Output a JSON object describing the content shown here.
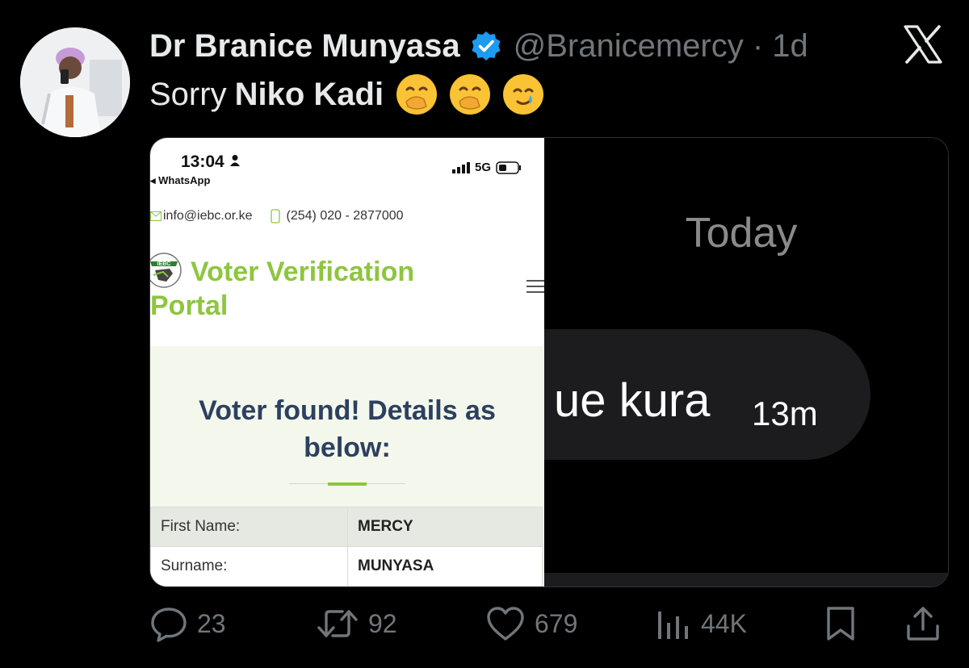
{
  "tweet": {
    "author_name": "Dr Branice Munyasa",
    "handle": "@Branicemercy",
    "separator": "·",
    "age": "1d",
    "text_prefix": "Sorry",
    "text_bold": "Niko Kadi",
    "emojis": [
      "hand-over-mouth-emoji",
      "hand-over-mouth-emoji",
      "smiling-face-with-tear-emoji"
    ]
  },
  "screenshot_left": {
    "time": "13:04",
    "back_app": "WhatsApp",
    "network": "5G",
    "email": "info@iebc.or.ke",
    "phone": "(254) 020 - 2877000",
    "logo_text": "IEBC",
    "portal_title_line1": "Voter Verification",
    "portal_title_line2": "Portal",
    "found_line1": "Voter found! Details as",
    "found_line2": "below:",
    "rows": [
      {
        "label": "First Name:",
        "value": "MERCY"
      },
      {
        "label": "Surname:",
        "value": "MUNYASA"
      }
    ]
  },
  "screenshot_right": {
    "day_label": "Today",
    "message": "ue kura",
    "message_time": "13m"
  },
  "actions": {
    "replies": "23",
    "reposts": "92",
    "likes": "679",
    "views": "44K"
  },
  "colors": {
    "background": "#000000",
    "text": "#e7e9ea",
    "muted": "#71767b",
    "verified": "#1d9bf0",
    "portal_green": "#8dc63f",
    "portal_navy": "#2c4060"
  }
}
